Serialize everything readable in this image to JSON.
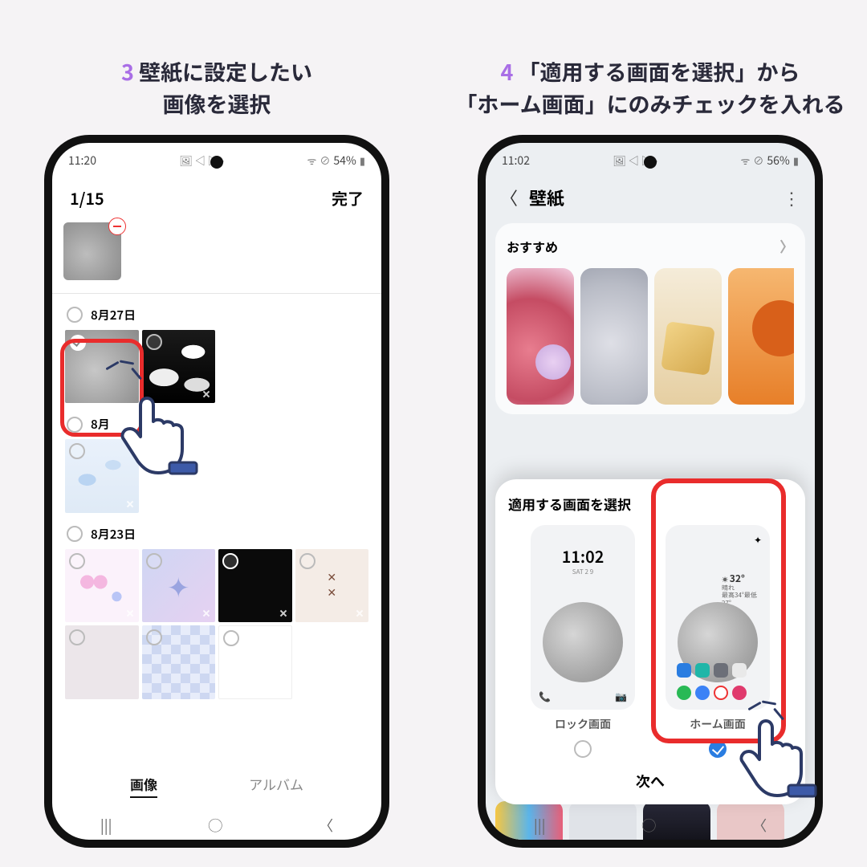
{
  "left": {
    "caption_num": "3",
    "caption": "壁紙に設定したい\n画像を選択",
    "status_time": "11:20",
    "status_battery": "54%",
    "counter": "1/15",
    "done": "完了",
    "dates": [
      "8月27日",
      "8月",
      "8月23日"
    ],
    "tabs": {
      "images": "画像",
      "albums": "アルバム"
    }
  },
  "right": {
    "caption_num": "4",
    "caption": "「適用する画面を選択」から\n「ホーム画面」にのみチェックを入れる",
    "status_time": "11:02",
    "status_battery": "56%",
    "title": "壁紙",
    "recommended": "おすすめ",
    "sheet_title": "適用する画面を選択",
    "lock_time": "11:02",
    "lock_label": "ロック画面",
    "home_label": "ホーム画面",
    "weather_temp": "32°",
    "next": "次へ"
  }
}
